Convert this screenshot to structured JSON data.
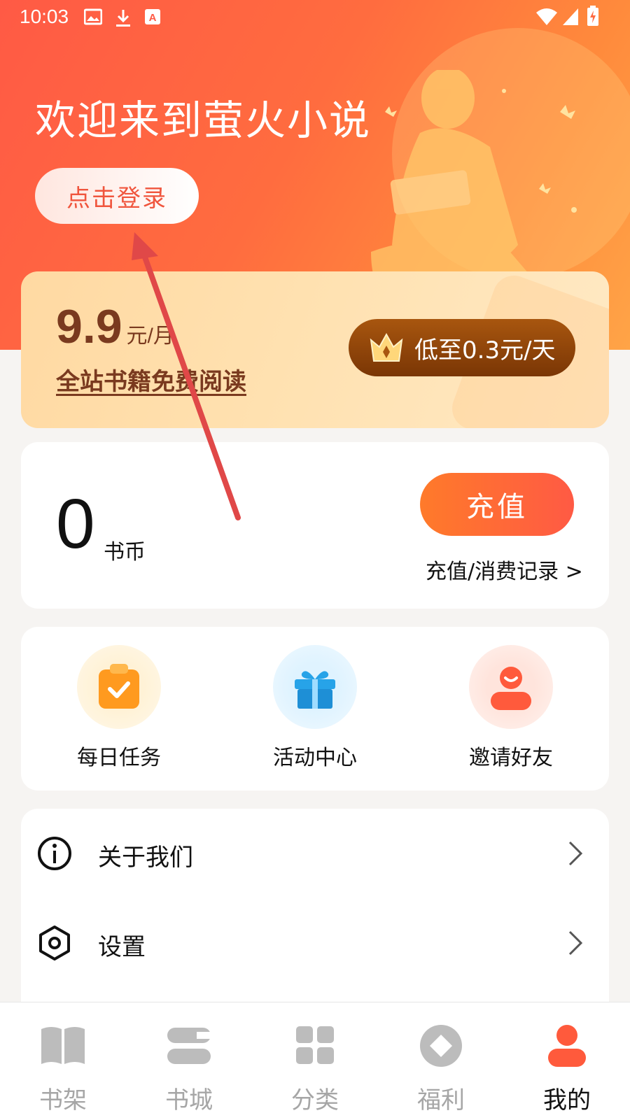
{
  "status_bar": {
    "time": "10:03",
    "left_icons": [
      "image-icon",
      "download-icon",
      "keyboard-a-icon"
    ],
    "right_icons": [
      "wifi-icon",
      "signal-icon",
      "battery-icon"
    ]
  },
  "header": {
    "welcome_text": "欢迎来到萤火小说",
    "login_button": "点击登录",
    "gradient_colors": [
      "#ff5a45",
      "#ffa447"
    ]
  },
  "vip_card": {
    "price": "9.9",
    "unit": "元/月",
    "description": "全站书籍免费阅读",
    "button_label": "低至0.3元/天",
    "button_icon": "crown-icon"
  },
  "coin_card": {
    "balance": "0",
    "currency_label": "书币",
    "recharge_button": "充值",
    "record_link": "充值/消费记录 >"
  },
  "quick_actions": [
    {
      "label": "每日任务",
      "icon": "task-clipboard-icon"
    },
    {
      "label": "活动中心",
      "icon": "gift-icon"
    },
    {
      "label": "邀请好友",
      "icon": "invite-user-icon"
    }
  ],
  "menu": [
    {
      "label": "关于我们",
      "icon": "info-icon"
    },
    {
      "label": "设置",
      "icon": "settings-hexagon-icon"
    }
  ],
  "tab_bar": {
    "active": "我的",
    "tabs": [
      {
        "label": "书架",
        "icon": "bookshelf-icon"
      },
      {
        "label": "书城",
        "icon": "bookstore-icon"
      },
      {
        "label": "分类",
        "icon": "category-grid-icon"
      },
      {
        "label": "福利",
        "icon": "welfare-diamond-icon"
      },
      {
        "label": "我的",
        "icon": "profile-icon"
      }
    ]
  },
  "colors": {
    "accent": "#ff5a44",
    "vip_brown": "#7a3a1f",
    "annotation_arrow": "#e04848"
  }
}
